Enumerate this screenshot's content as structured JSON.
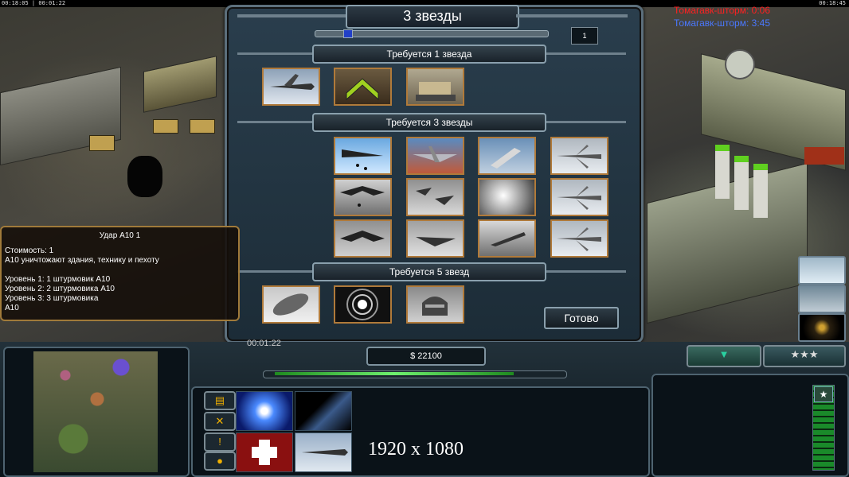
{
  "hud_top": {
    "left_clock": "00:18:05 | 00:01:22",
    "right_clock": "00:18:45",
    "timers": [
      {
        "label": "Томагавк-шторм: 0:06",
        "color": "#ff2020"
      },
      {
        "label": "Томагавк-шторм: 3:45",
        "color": "#4a78ff"
      }
    ]
  },
  "general_dialog": {
    "title": "3 звезды",
    "page_value": "1",
    "sections": [
      {
        "header": "Требуется 1 звезда",
        "items": [
          "drone-icon",
          "upgrade-chevron-icon",
          "bulldozer-icon"
        ]
      },
      {
        "header": "Требуется 3 звезды",
        "items": [
          "bomber-drop-icon",
          "a10-attack-icon",
          "wrench-repair-icon",
          "jet-fighter-icon",
          "stealth-bomber-icon",
          "jet-squadron-icon",
          "explosion-icon",
          "jet-fighter-icon",
          "stealth-bomber-icon",
          "twin-jet-icon",
          "jet-strike-icon",
          "jet-fighter-icon"
        ]
      },
      {
        "header": "Требуется 5 звезд",
        "items": [
          "bomb-icon",
          "emp-pulse-icon",
          "helmet-icon"
        ]
      }
    ],
    "done_label": "Готово"
  },
  "tooltip": {
    "title": "Удар A10 1",
    "body": "Стоимость: 1\nA10 уничтожают здания, технику и пехоту\n\nУровень 1: 1 штурмовик A10\nУровень 2: 2 штурмовика A10\nУровень 3: 3 штурмовика\nA10"
  },
  "bottom_hud": {
    "money": "$ 22100",
    "minimap_time": "00:01:22",
    "power_level": 0.8,
    "side_buttons": [
      "structures-icon",
      "tools-icon",
      "alert-icon",
      "chat-icon"
    ],
    "build_icons": [
      "nuclear-icon",
      "satellite-icon",
      "medic-icon",
      "drone-icon"
    ],
    "resolution_text": "1920 x 1080",
    "rank_stars": "★★★"
  },
  "colors": {
    "accent": "#b07a3a",
    "frame": "#8aa0ad",
    "power": "#6ef06e"
  }
}
